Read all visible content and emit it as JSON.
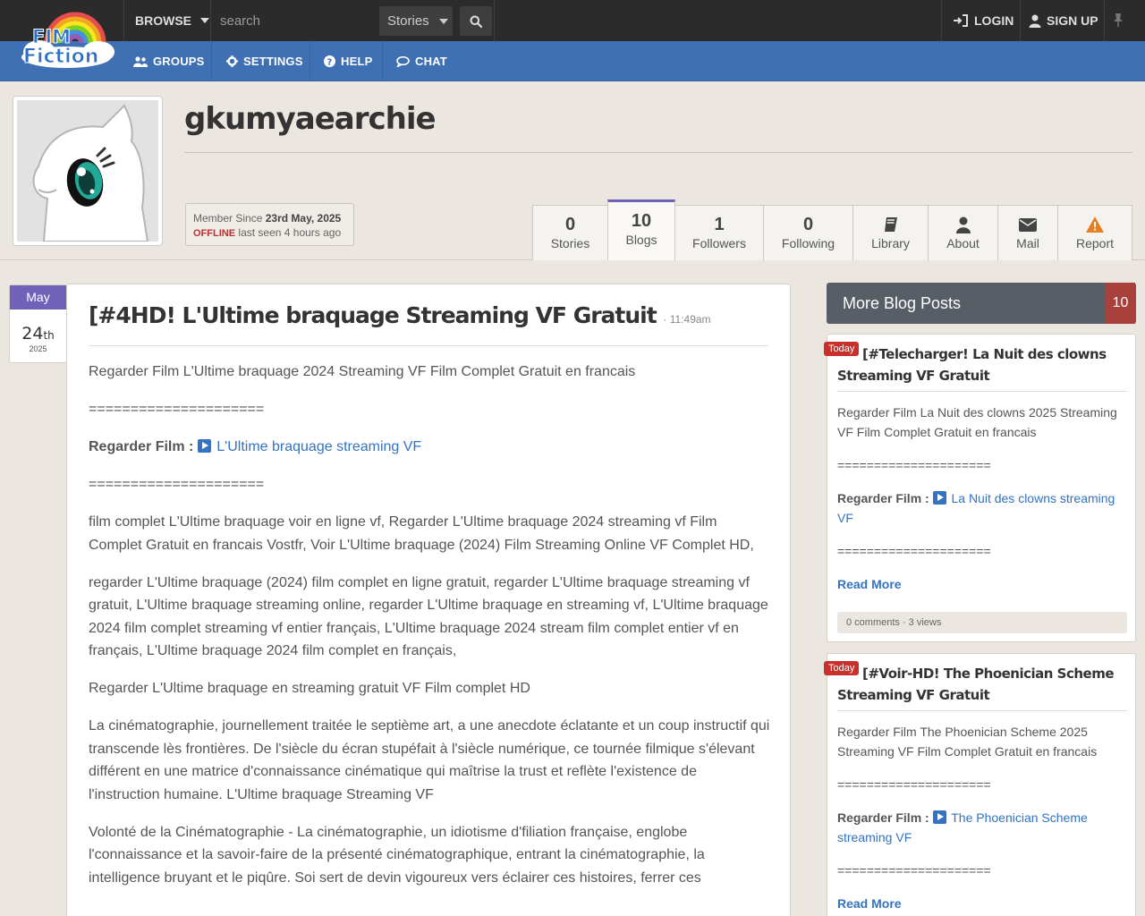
{
  "header": {
    "logo_text_line1": "FIM",
    "logo_text_line2": "Fiction",
    "browse_label": "BROWSE",
    "search_placeholder": "search",
    "search_type": "Stories",
    "login_label": "LOGIN",
    "signup_label": "SIGN UP"
  },
  "nav": {
    "groups": "GROUPS",
    "settings": "SETTINGS",
    "help": "HELP",
    "chat": "CHAT"
  },
  "profile": {
    "username": "gkumyaearchie",
    "member_since_label": "Member Since",
    "member_since_date": "23rd May, 2025",
    "status": "OFFLINE",
    "last_seen": "last seen 4 hours ago",
    "tabs": [
      {
        "count": "0",
        "label": "Stories"
      },
      {
        "count": "10",
        "label": "Blogs"
      },
      {
        "count": "1",
        "label": "Followers"
      },
      {
        "count": "0",
        "label": "Following"
      },
      {
        "label": "Library"
      },
      {
        "label": "About"
      },
      {
        "label": "Mail"
      },
      {
        "label": "Report"
      }
    ]
  },
  "post": {
    "month": "May",
    "day": "24",
    "day_suffix": "th",
    "year": "2025",
    "title": "[#4HD! L'Ultime braquage Streaming VF Gratuit",
    "time": "· 11:49am",
    "intro": "Regarder Film L'Ultime braquage 2024 Streaming VF Film Complet Gratuit en francais",
    "separator": "=====================",
    "watch_label": "Regarder Film :",
    "watch_link": "L'Ultime braquage streaming VF",
    "para1": "film complet L'Ultime braquage voir en ligne vf, Regarder L'Ultime braquage 2024 streaming vf Film Complet Gratuit en francais Vostfr, Voir L'Ultime braquage (2024) Film Streaming Online VF Complet HD,",
    "para2": "regarder L'Ultime braquage (2024) film complet en ligne gratuit, regarder L'Ultime braquage streaming vf gratuit, L'Ultime braquage streaming online, regarder L'Ultime braquage en streaming vf, L'Ultime braquage 2024 film complet streaming vf entier français, L'Ultime braquage 2024 stream film complet entier vf en français, L'Ultime braquage 2024 film complet en français,",
    "para3": "Regarder L'Ultime braquage en streaming gratuit VF Film complet HD",
    "para4": "La cinématographie, journellement traitée le septième art, a une anecdote éclatante et un coup instructif qui transcende lès frontières. De l'siècle du écran stupéfait à l'siècle numérique, ce tournée filmique s'élevant différent en une matrice d'connaissance cinématique qui maîtrise la trust et reflète l'existence de l'instruction humaine. L'Ultime braquage Streaming VF",
    "para5": "Volonté de la Cinématographie - La cinématographie, un idiotisme d'filiation française, englobe l'connaissance et la savoir-faire de la présenté cinématographique, entrant la cinématographie, la intelligence bruyant et le piqûre. Soi sert de devin vigoureux vers éclairer ces histoires, ferrer ces"
  },
  "sidebar": {
    "title": "More Blog Posts",
    "count": "10",
    "cards": [
      {
        "badge": "Today",
        "title": "[#Telecharger! La Nuit des clowns Streaming VF Gratuit",
        "intro": "Regarder Film La Nuit des clowns 2025 Streaming VF Film Complet Gratuit en francais",
        "separator": "=====================",
        "watch_label": "Regarder Film :",
        "watch_link": "La Nuit des clowns streaming VF",
        "read_more": "Read More",
        "footer": "0 comments · 3 views"
      },
      {
        "badge": "Today",
        "title": "[#Voir-HD! The Phoenician Scheme Streaming VF Gratuit",
        "intro": "Regarder Film The Phoenician Scheme 2025 Streaming VF Film Complet Gratuit en francais",
        "separator": "=====================",
        "watch_label": "Regarder Film :",
        "watch_link": "The Phoenician Scheme streaming VF",
        "read_more": "Read More"
      }
    ]
  },
  "colors": {
    "topbar": "#2b2b2b",
    "navbar": "#3f70b3",
    "accent_purple": "#7062b8",
    "link": "#3273c4",
    "badge_red": "#c9302c"
  },
  "icons": [
    "users-icon",
    "gear-icon",
    "help-icon",
    "chat-icon",
    "search-icon",
    "login-icon",
    "user-icon",
    "pin-icon",
    "book-icon",
    "envelope-icon",
    "warning-icon",
    "play-icon"
  ]
}
